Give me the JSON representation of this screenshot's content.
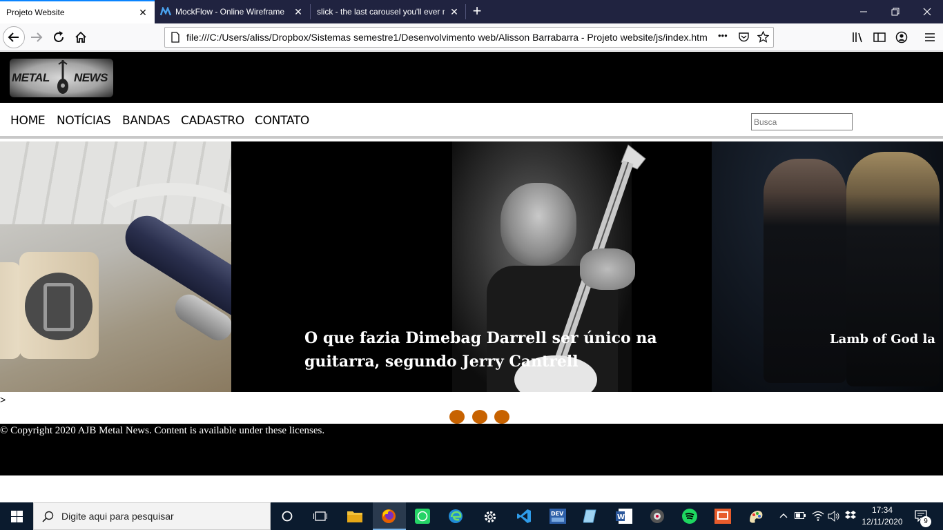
{
  "browser": {
    "tabs": [
      {
        "title": "Projeto Website",
        "active": true
      },
      {
        "title": "MockFlow - Online Wireframe",
        "active": false
      },
      {
        "title": "slick - the last carousel you'll ever n",
        "active": false
      }
    ],
    "new_tab_label": "+",
    "url": "file:///C:/Users/aliss/Dropbox/Sistemas semestre1/Desenvolvimento web/Alisson Barrabarra - Projeto website/js/index.htm",
    "url_more_label": "•••",
    "window_controls": {
      "minimize": "—",
      "restore": "❐",
      "close": "✕"
    }
  },
  "site": {
    "logo_text": {
      "left": "METAL",
      "right": "NEWS"
    },
    "menu": [
      "HOME",
      "NOTÍCIAS",
      "BANDAS",
      "CADASTRO",
      "CONTATO"
    ],
    "search_placeholder": "Busca",
    "slides": [
      {
        "caption": ""
      },
      {
        "caption_line1": "O que fazia Dimebag Darrell ser único na",
        "caption_line2": "guitarra, segundo Jerry Cantrell"
      },
      {
        "caption": "Lamb of God la"
      }
    ],
    "stray_text": ">",
    "carousel_dots": 3,
    "footer": "© Copyright 2020 AJB Metal News. Content is available under these licenses.",
    "colors": {
      "dot": "#c76200",
      "header_bg": "#000000",
      "tab_accent": "#0a84ff"
    }
  },
  "taskbar": {
    "search_placeholder": "Digite aqui para pesquisar",
    "time": "17:34",
    "date": "12/11/2020",
    "notifications_count": "9",
    "apps": [
      "task-view-icon",
      "file-explorer-icon",
      "firefox-icon",
      "whatsapp-icon",
      "edge-icon",
      "settings-icon",
      "vscode-icon",
      "dev-cpp-icon",
      "notepad-icon",
      "word-icon",
      "media-player-icon",
      "spotify-icon",
      "presentation-icon",
      "paint-icon"
    ]
  }
}
